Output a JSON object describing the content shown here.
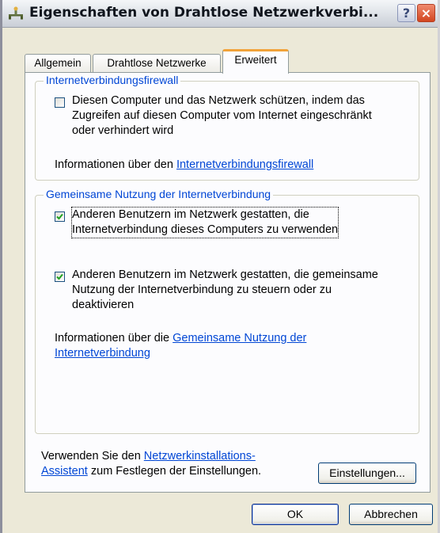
{
  "window": {
    "title": "Eigenschaften von Drahtlose Netzwerkverbi...",
    "help_label": "?",
    "close_label": "×"
  },
  "tabs": [
    {
      "label": "Allgemein",
      "active": false
    },
    {
      "label": "Drahtlose Netzwerke",
      "active": false
    },
    {
      "label": "Erweitert",
      "active": true
    }
  ],
  "firewall": {
    "group_title": "Internetverbindungsfirewall",
    "checkbox_checked": false,
    "checkbox_label_lines": [
      "Diesen Computer und das Netzwerk schützen, indem das",
      "Zugreifen auf diesen Computer vom Internet eingeschränkt",
      "oder verhindert wird"
    ],
    "info_text": "Informationen über den",
    "info_link": "Internetverbindungsfirewall"
  },
  "ics": {
    "group_title": "Gemeinsame Nutzung der Internetverbindung",
    "checkbox1_checked": true,
    "checkbox1_label_lines": [
      "Anderen Benutzern im Netzwerk gestatten, die",
      "Internetverbindung dieses Computers zu verwenden"
    ],
    "checkbox2_checked": true,
    "checkbox2_label_lines": [
      "Anderen Benutzern im Netzwerk gestatten, die gemeinsame",
      "Nutzung der Internetverbindung zu steuern oder zu",
      "deaktivieren"
    ],
    "info_text": "Informationen über die",
    "info_link_line1": "Gemeinsame Nutzung der",
    "info_link_line2": "Internetverbindung"
  },
  "footer": {
    "text_prefix": "Verwenden Sie den",
    "link_line1": "Netzwerkinstallations-",
    "link_line2": "Assistent",
    "text_suffix": "zum Festlegen der Einstellungen.",
    "settings_button": "Einstellungen..."
  },
  "buttons": {
    "ok": "OK",
    "cancel": "Abbrechen"
  }
}
